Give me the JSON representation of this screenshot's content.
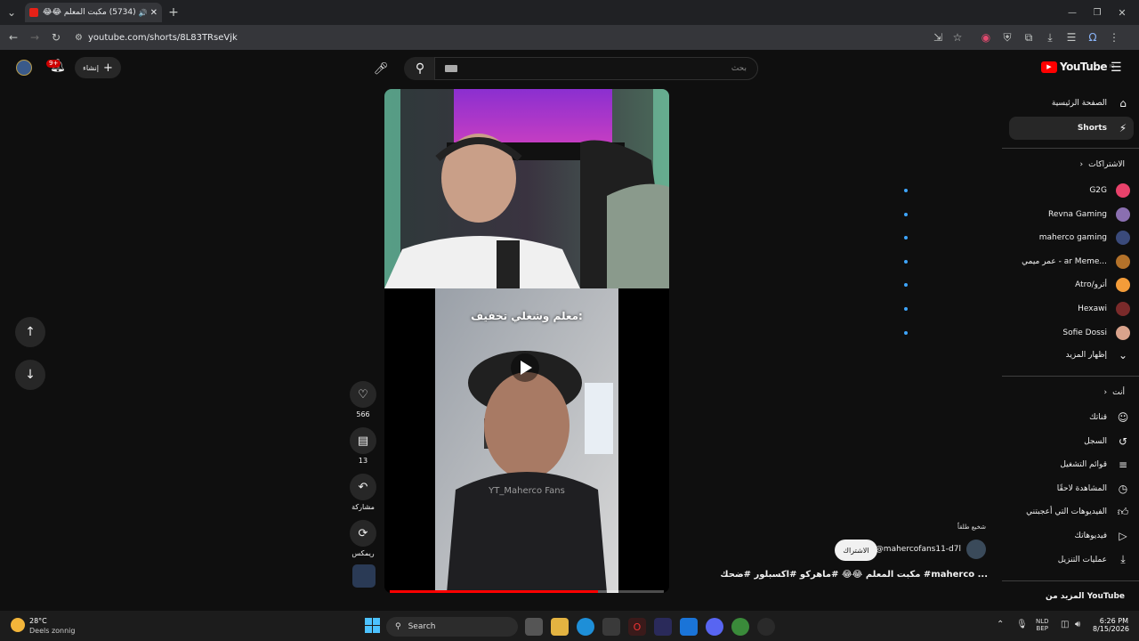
{
  "browser": {
    "tab_title": "(5734) مكبت المعلم 😂😂 #",
    "url": "youtube.com/shorts/8L83TRseVjk"
  },
  "topbar": {
    "create_label": "إنشاء",
    "notif_badge": "9+",
    "search_placeholder": "بحث",
    "logo_text": "YouTube",
    "logo_region": "IQ"
  },
  "sidebar": {
    "home": "الصفحة الرئيسية",
    "shorts": "Shorts",
    "subs_header": "الاشتراكات",
    "subs": [
      {
        "name": "G2G",
        "color": "#e8426b"
      },
      {
        "name": "Revna Gaming",
        "color": "#8a6fb0"
      },
      {
        "name": "maherco gaming",
        "color": "#3a4a7a"
      },
      {
        "name": "عمر ميمي - ar Meme...",
        "color": "#b3722a"
      },
      {
        "name": "Atro/أترو",
        "color": "#f39c39"
      },
      {
        "name": "Hexawi",
        "color": "#7a2a2a"
      },
      {
        "name": "Sofie Dossi",
        "color": "#d9a38c"
      }
    ],
    "show_more": "إظهار المزيد",
    "you_header": "أنت",
    "you_items": [
      {
        "label": "قناتك",
        "icon": "person-box-icon"
      },
      {
        "label": "السجل",
        "icon": "history-icon"
      },
      {
        "label": "قوائم التشغيل",
        "icon": "playlist-icon"
      },
      {
        "label": "المشاهدة لاحقًا",
        "icon": "clock-icon"
      },
      {
        "label": "الفيديوهات التي أعجبتني",
        "icon": "thumb-up-icon"
      },
      {
        "label": "فيديوهاتك",
        "icon": "play-box-icon"
      },
      {
        "label": "عمليات التنزيل",
        "icon": "download-icon"
      }
    ],
    "more_from": "المزيد من YouTube"
  },
  "video": {
    "overlay_text": "معلم وشغلي تخفيف:",
    "watermark": "YT_Maherco Fans",
    "channel": "@mahercofans11-d7l",
    "subscribe": "الاشتراك",
    "promo": "شخيع طلقاً",
    "title": "مكبت المعلم 😂😂 #ماهركو #اكسبلور #ضحك #maherco ...",
    "progress": 0.76
  },
  "actions": {
    "likes": "566",
    "comments": "13",
    "share": "مشاركة",
    "remix": "ريمكس"
  },
  "taskbar": {
    "temp": "28°C",
    "weather": "Deels zonnig",
    "search": "Search",
    "lang1": "NLD",
    "lang2": "BEP",
    "time": "6:26 PM",
    "date": "8/15/2026"
  }
}
